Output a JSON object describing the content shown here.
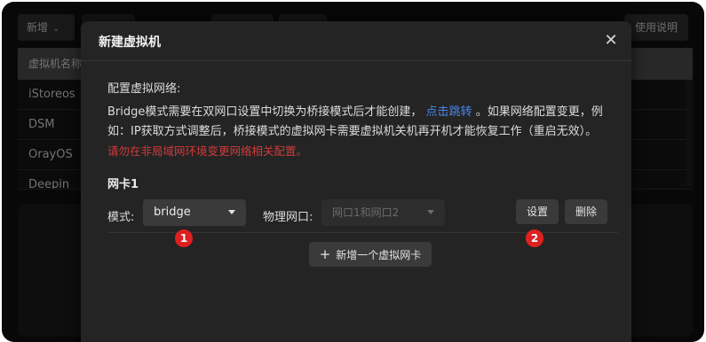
{
  "background": {
    "toolbar": {
      "new_label": "新增",
      "help_label": "使用说明"
    },
    "table": {
      "header": "虚拟机名称",
      "rows": [
        "iStoreos",
        "DSM",
        "OrayOS",
        "Deepin"
      ]
    }
  },
  "modal": {
    "title": "新建虚拟机",
    "section_label": "配置虚拟网络:",
    "desc_part1": "Bridge模式需要在双网口设置中切换为桥接模式后才能创建，",
    "desc_link": "点击跳转",
    "desc_part2": "。如果网络配置变更，例如：IP获取方式调整后，桥接模式的虚拟网卡需要虚拟机关机再开机才能恢复工作（重启无效）。",
    "desc_warning": "请勿在非局域网环境变更网络相关配置。",
    "nic": {
      "title": "网卡1",
      "mode_label": "模式:",
      "mode_value": "bridge",
      "port_label": "物理网口:",
      "port_value": "网口1和网口2",
      "settings_label": "设置",
      "delete_label": "删除"
    },
    "add_nic_label": "新增一个虚拟网卡"
  },
  "annotations": {
    "badge1": "1",
    "badge2": "2"
  },
  "colors": {
    "link": "#4c86f0",
    "warning": "#d23a3a",
    "badge": "#e02020"
  },
  "icons": {
    "close": "close-icon",
    "caret": "caret-down-icon",
    "plus": "plus-icon",
    "chevron": "chevron-down-icon"
  }
}
